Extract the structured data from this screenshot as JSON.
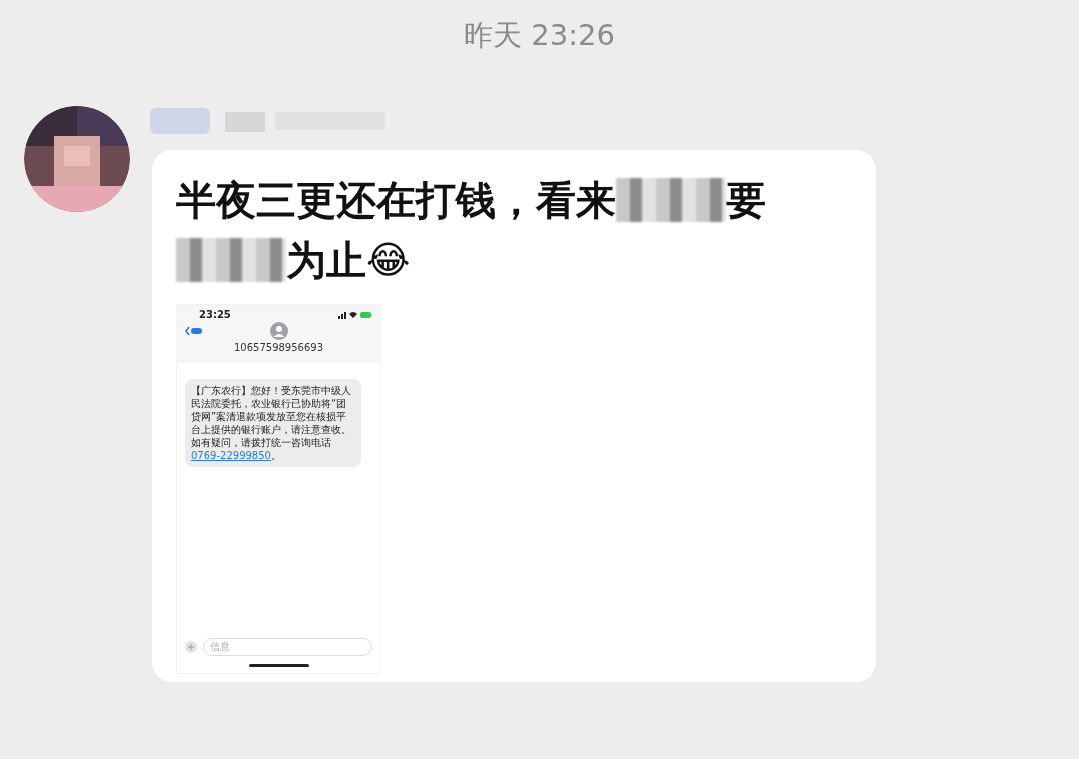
{
  "timestamp": "昨天 23:26",
  "message": {
    "lines": [
      [
        {
          "kind": "text",
          "text": "半夜三更还在打钱，看来"
        },
        {
          "kind": "redacted"
        },
        {
          "kind": "text",
          "text": "要"
        }
      ],
      [
        {
          "kind": "redacted"
        },
        {
          "kind": "text",
          "text": "为止"
        },
        {
          "kind": "emoji",
          "text": "😂"
        }
      ]
    ]
  },
  "screenshot": {
    "time": "23:25",
    "sender": "10657598956693",
    "sms_text": "【广东农行】您好！受东莞市中级人民法院委托，农业银行已协助将“团贷网”案清退款项发放至您在核损平台上提供的银行账户，请注意查收。如有疑问，请拨打统一咨询电话",
    "sms_link": "0769-22999850",
    "sms_end": "。",
    "input_placeholder": "信息"
  }
}
